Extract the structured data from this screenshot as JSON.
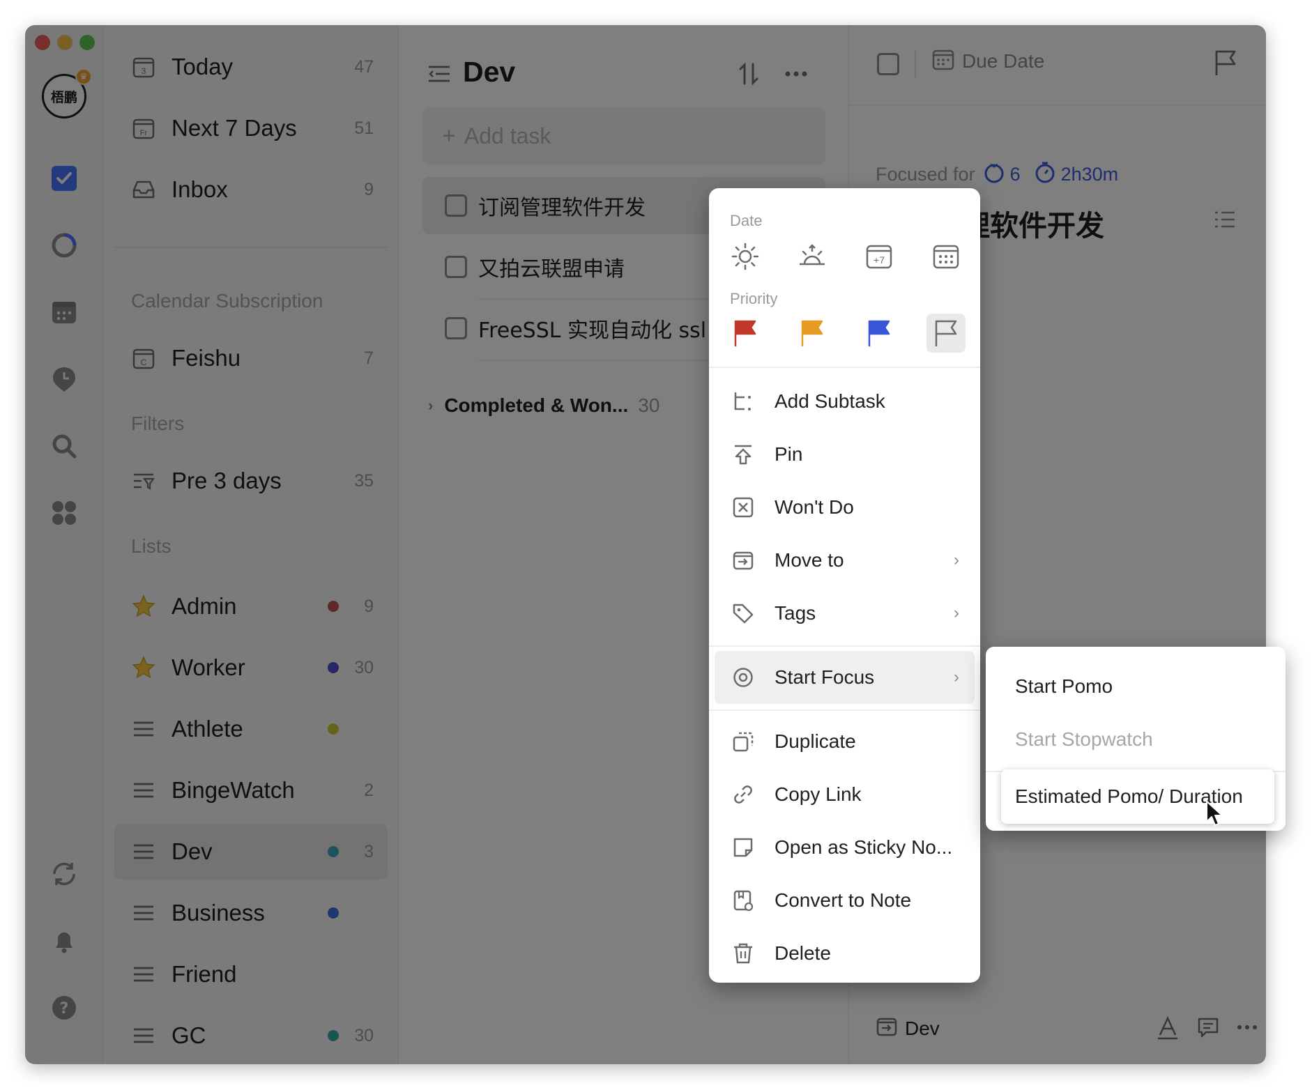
{
  "rail": {
    "avatar_text": "梧鹏",
    "icons": [
      "tasks-icon",
      "habit-ring-icon",
      "calendar-grid-icon",
      "pin-clock-icon",
      "search-icon",
      "apps-icon",
      "sync-icon",
      "bell-icon",
      "help-icon"
    ]
  },
  "sidebar": {
    "smart": [
      {
        "label": "Today",
        "count": "47",
        "icon": "calendar-day-icon"
      },
      {
        "label": "Next 7 Days",
        "count": "51",
        "icon": "calendar-week-icon"
      },
      {
        "label": "Inbox",
        "count": "9",
        "icon": "inbox-icon"
      }
    ],
    "calendar_section": "Calendar Subscription",
    "calendar_items": [
      {
        "label": "Feishu",
        "count": "7"
      }
    ],
    "filters_section": "Filters",
    "filter_items": [
      {
        "label": "Pre 3 days",
        "count": "35"
      }
    ],
    "lists_section": "Lists",
    "lists": [
      {
        "label": "Admin",
        "count": "9",
        "dot": "#c0504d",
        "icon": "star"
      },
      {
        "label": "Worker",
        "count": "30",
        "dot": "#4a4ecf",
        "icon": "star"
      },
      {
        "label": "Athlete",
        "count": "",
        "dot": "#c9c93a",
        "icon": "list"
      },
      {
        "label": "BingeWatch",
        "count": "2",
        "dot": "",
        "icon": "list"
      },
      {
        "label": "Dev",
        "count": "3",
        "dot": "#3aa6b8",
        "icon": "list",
        "active": true
      },
      {
        "label": "Business",
        "count": "",
        "dot": "#3f6fe0",
        "icon": "list"
      },
      {
        "label": "Friend",
        "count": "",
        "dot": "",
        "icon": "list"
      },
      {
        "label": "GC",
        "count": "30",
        "dot": "#3aa6a0",
        "icon": "list"
      }
    ]
  },
  "tasklist": {
    "title": "Dev",
    "add_placeholder": "Add task",
    "tasks": [
      {
        "text": "订阅管理软件开发",
        "selected": true
      },
      {
        "text": "又拍云联盟申请",
        "selected": false
      },
      {
        "text": "FreeSSL 实现自动化 ssl",
        "selected": false
      }
    ],
    "completed_label": "Completed & Won...",
    "completed_count": "30"
  },
  "detail": {
    "due_date_label": "Due Date",
    "focused_for": "Focused for",
    "pomo_count": "6",
    "duration": "2h30m",
    "title": "订阅管理软件开发",
    "list_name": "Dev"
  },
  "menu": {
    "date_label": "Date",
    "priority_label": "Priority",
    "priority_colors": [
      "#c0392b",
      "#e69b23",
      "#3a55d6",
      "#6b6b6b"
    ],
    "items": [
      {
        "label": "Add Subtask",
        "icon": "subtask-icon",
        "chevron": false
      },
      {
        "label": "Pin",
        "icon": "pin-icon",
        "chevron": false
      },
      {
        "label": "Won't Do",
        "icon": "wont-do-icon",
        "chevron": false
      },
      {
        "label": "Move to",
        "icon": "move-to-icon",
        "chevron": true
      },
      {
        "label": "Tags",
        "icon": "tag-icon",
        "chevron": true
      }
    ],
    "focus_item": {
      "label": "Start Focus",
      "icon": "focus-icon"
    },
    "items2": [
      {
        "label": "Duplicate",
        "icon": "duplicate-icon"
      },
      {
        "label": "Copy Link",
        "icon": "link-icon"
      },
      {
        "label": "Open as Sticky No...",
        "icon": "sticky-note-icon"
      },
      {
        "label": "Convert to Note",
        "icon": "note-icon"
      },
      {
        "label": "Delete",
        "icon": "trash-icon"
      }
    ]
  },
  "submenu": {
    "items": [
      {
        "label": "Start Pomo",
        "disabled": false
      },
      {
        "label": "Start Stopwatch",
        "disabled": true
      },
      {
        "label": "Estimated Pomo/ Duration",
        "disabled": false,
        "highlighted": true
      }
    ]
  }
}
